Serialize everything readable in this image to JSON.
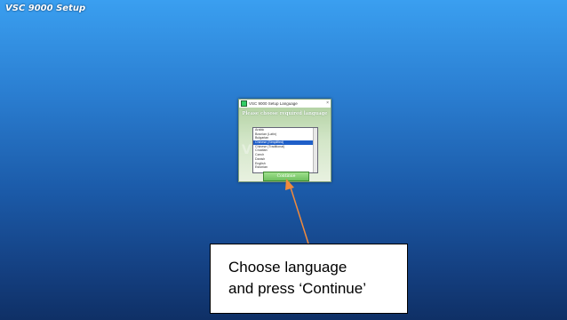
{
  "app": {
    "title": "VSC 9000 Setup"
  },
  "dialog": {
    "title": "VSC 9000 Setup Language",
    "close": "×",
    "heading": "Please choose required language",
    "watermark": "VSC",
    "languages": [
      "Arabic",
      "Bosnian (Latin)",
      "Bulgarian",
      "Chinese (Simplified)",
      "Chinese (Traditional)",
      "Croatian",
      "Czech",
      "Danish",
      "English",
      "Estonian"
    ],
    "selected_index": 3,
    "continue_label": "Continue"
  },
  "callout": {
    "line1": "Choose language",
    "line2": "and press ‘Continue’",
    "arrow_color": "#f08a3c"
  }
}
